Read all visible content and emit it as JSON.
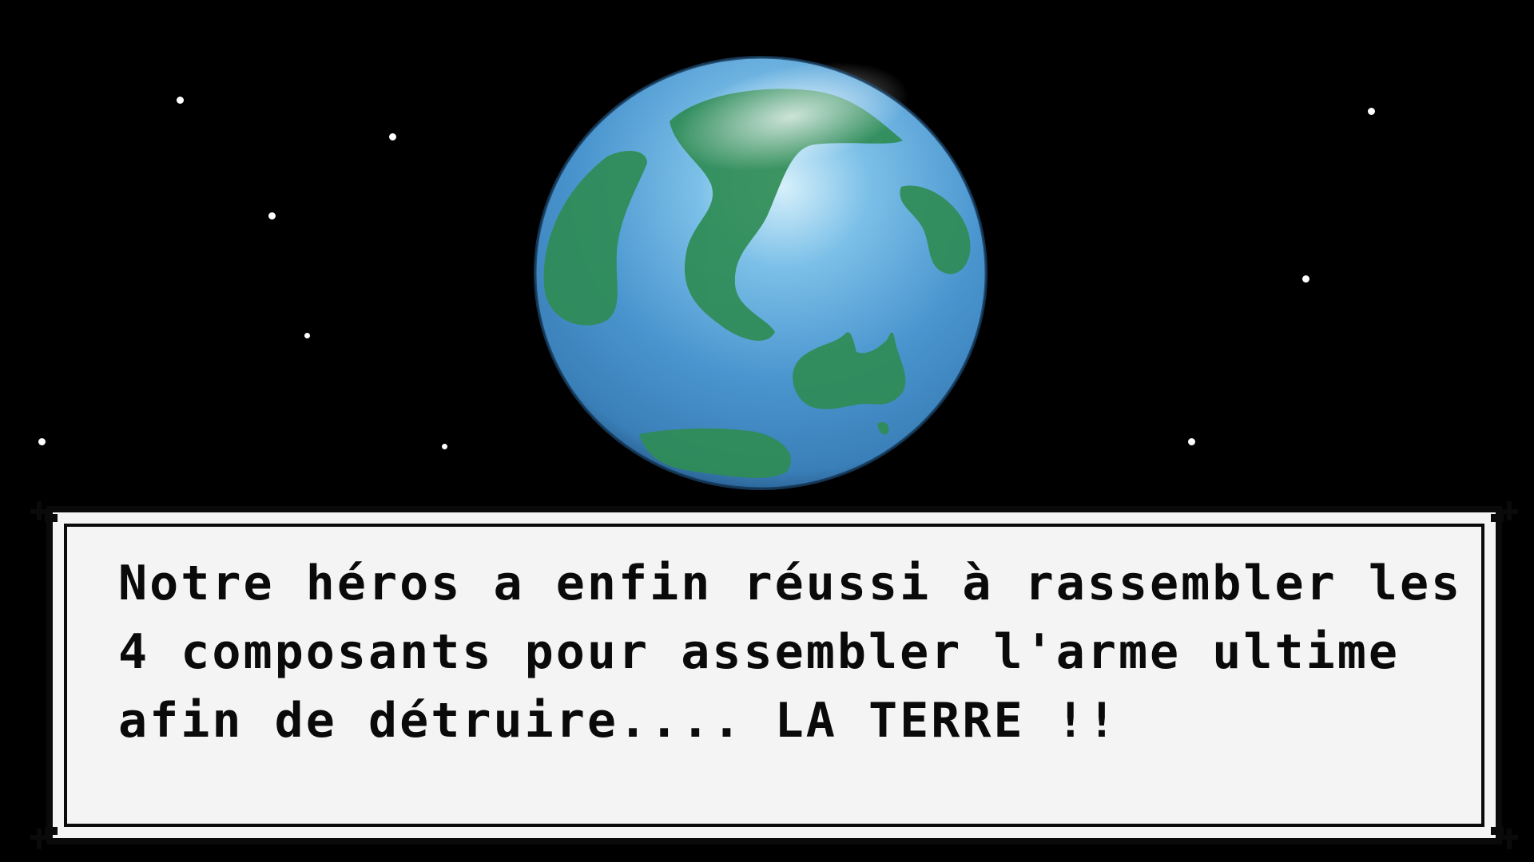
{
  "scene": {
    "background_color": "#000000",
    "star_color": "#ffffff",
    "planet": "earth-globe",
    "planet_colors": {
      "ocean": "#4a95cf",
      "land": "#2f8c55",
      "rim": "#1f4e7a"
    }
  },
  "dialog": {
    "lines": [
      "Notre héros a enfin réussi à rassembler les",
      "4 composants pour assembler l'arme ultime",
      "afin de détruire.... LA TERRE !!"
    ],
    "box_color": "#f4f4f4",
    "border_color": "#0a0a0a",
    "text_color": "#0a0a0a"
  }
}
